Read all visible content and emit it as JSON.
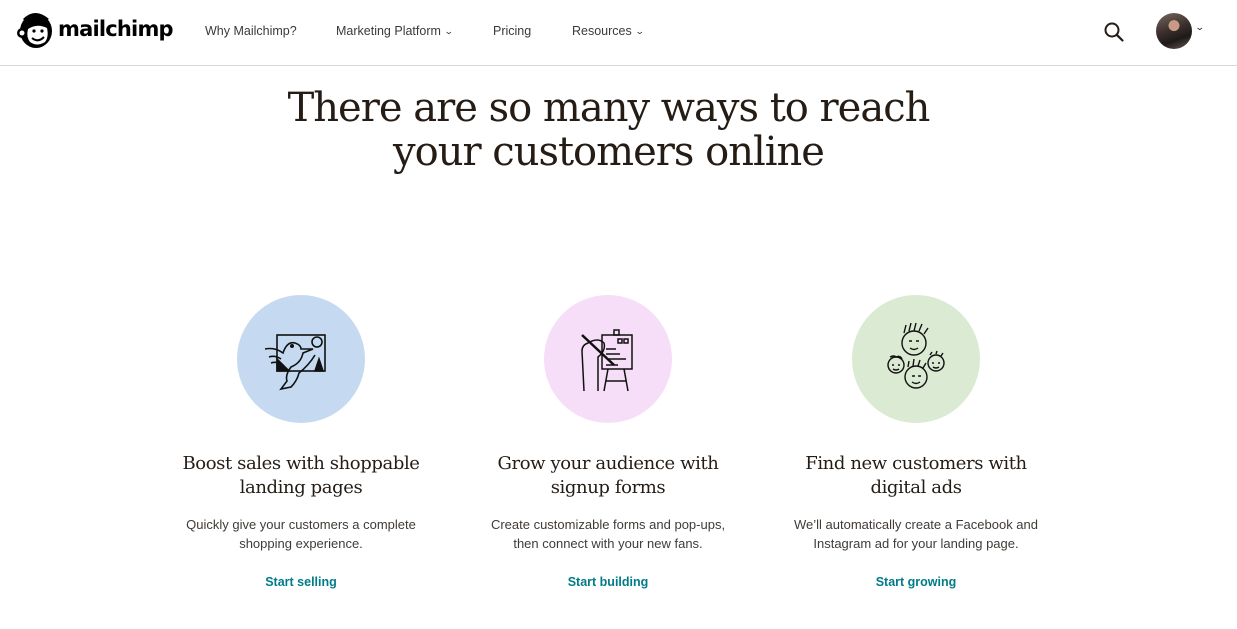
{
  "brand": {
    "name": "mailchimp",
    "logo_icon": "freddie-monkey-icon"
  },
  "nav": {
    "items": [
      {
        "label": "Why Mailchimp?",
        "has_dropdown": false
      },
      {
        "label": "Marketing Platform",
        "has_dropdown": true
      },
      {
        "label": "Pricing",
        "has_dropdown": false
      },
      {
        "label": "Resources",
        "has_dropdown": true
      }
    ],
    "chevron_glyph": "⌄",
    "search_icon": "search-icon",
    "avatar_icon": "user-avatar",
    "avatar_chevron_glyph": "⌄"
  },
  "hero": {
    "line1": "There are so many ways to reach",
    "line2": "your customers online"
  },
  "cards": [
    {
      "illustration": "bird-landing-page-illustration",
      "circle_color": "#c5daf1",
      "title_line1": "Boost sales with shoppable",
      "title_line2": "landing pages",
      "desc_line1": "Quickly give your customers a complete",
      "desc_line2": "shopping experience.",
      "link": "Start selling"
    },
    {
      "illustration": "hand-signup-form-illustration",
      "circle_color": "#f6def8",
      "title_line1": "Grow your audience with",
      "title_line2": "signup forms",
      "desc_line1": "Create customizable forms and pop-ups,",
      "desc_line2": "then connect with your new fans.",
      "link": "Start building"
    },
    {
      "illustration": "faces-crowd-illustration",
      "circle_color": "#dbead3",
      "title_line1": "Find new customers with",
      "title_line2": "digital ads",
      "desc_line1": "We’ll automatically create a Facebook and",
      "desc_line2": "Instagram ad for your landing page.",
      "link": "Start growing"
    }
  ],
  "colors": {
    "link": "#007c89",
    "text": "#241c15",
    "border": "#d9d9d4"
  }
}
